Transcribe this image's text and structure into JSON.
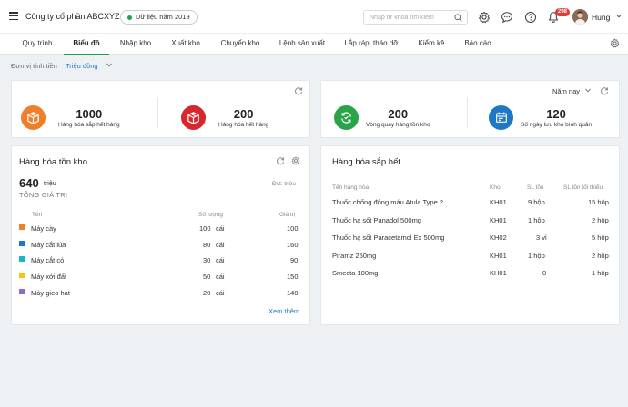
{
  "topbar": {
    "company": "Công ty cổ phần ABCXYZ",
    "year_pill": "Dữ liệu năm 2019",
    "search_placeholder": "Nhập từ khóa tìm kiếm",
    "notification_count": "298",
    "user_name": "Hùng"
  },
  "nav": {
    "tabs": [
      "Quy trình",
      "Biểu đồ",
      "Nhập kho",
      "Xuất kho",
      "Chuyển kho",
      "Lệnh sản xuất",
      "Lắp ráp, tháo dỡ",
      "Kiểm kê",
      "Báo cáo"
    ],
    "active_tab": "Biểu đồ"
  },
  "filter": {
    "unit_label": "Đơn vị tính tiền",
    "unit_value": "Triệu đồng"
  },
  "stats_left": [
    {
      "value": "1000",
      "label": "Hàng hóa sắp hết hàng",
      "color": "#f07f2b",
      "icon": "box-icon"
    },
    {
      "value": "200",
      "label": "Hàng hóa hết hàng",
      "color": "#d7262c",
      "icon": "box-icon"
    }
  ],
  "stats_right": {
    "period": "Năm nay",
    "items": [
      {
        "value": "200",
        "label": "Vòng quay hàng tồn kho",
        "color": "#2aa44a",
        "icon": "cycle-icon"
      },
      {
        "value": "120",
        "label": "Số ngày lưu kho bình quân",
        "color": "#1e78c8",
        "icon": "calendar-icon"
      }
    ]
  },
  "inventory": {
    "title": "Hàng hóa tồn kho",
    "total_value": "640",
    "total_unit": "triệu",
    "total_label": "TỔNG GIÁ TRỊ",
    "unit_note": "Đvt: triệu",
    "headers": [
      "Tên",
      "Số lượng",
      "Giá trị"
    ],
    "rows": [
      {
        "name": "Máy cày",
        "qty": "100",
        "unit": "cái",
        "value": "100",
        "color": "#f07f2b"
      },
      {
        "name": "Máy cắt lúa",
        "qty": "80",
        "unit": "cái",
        "value": "160",
        "color": "#1e78c8"
      },
      {
        "name": "Máy cắt cỏ",
        "qty": "30",
        "unit": "cái",
        "value": "90",
        "color": "#18b6c4"
      },
      {
        "name": "Máy xới đất",
        "qty": "50",
        "unit": "cái",
        "value": "150",
        "color": "#f5c518"
      },
      {
        "name": "Máy gieo hạt",
        "qty": "20",
        "unit": "cái",
        "value": "140",
        "color": "#8e6cc8"
      }
    ],
    "more": "Xem thêm"
  },
  "low_stock": {
    "title": "Hàng hóa sắp hết",
    "headers": [
      "Tên hàng hóa",
      "Kho",
      "SL tồn",
      "SL tồn tối thiểu"
    ],
    "rows": [
      {
        "name": "Thuốc chống đông máu Atula Type 2",
        "store": "KH01",
        "stock": "9 hộp",
        "min": "15 hộp"
      },
      {
        "name": "Thuốc hạ sốt Panadol 500mg",
        "store": "KH01",
        "stock": "1 hộp",
        "min": "2 hộp"
      },
      {
        "name": "Thuốc hạ sốt Paracetamol Ex 500mg",
        "store": "KH02",
        "stock": "3 vỉ",
        "min": "5 hộp"
      },
      {
        "name": "Piramz 250mg",
        "store": "KH01",
        "stock": "1 hộp",
        "min": "2 hộp"
      },
      {
        "name": "Smecta 100mg",
        "store": "KH01",
        "stock": "0",
        "min": "1 hộp"
      }
    ]
  }
}
